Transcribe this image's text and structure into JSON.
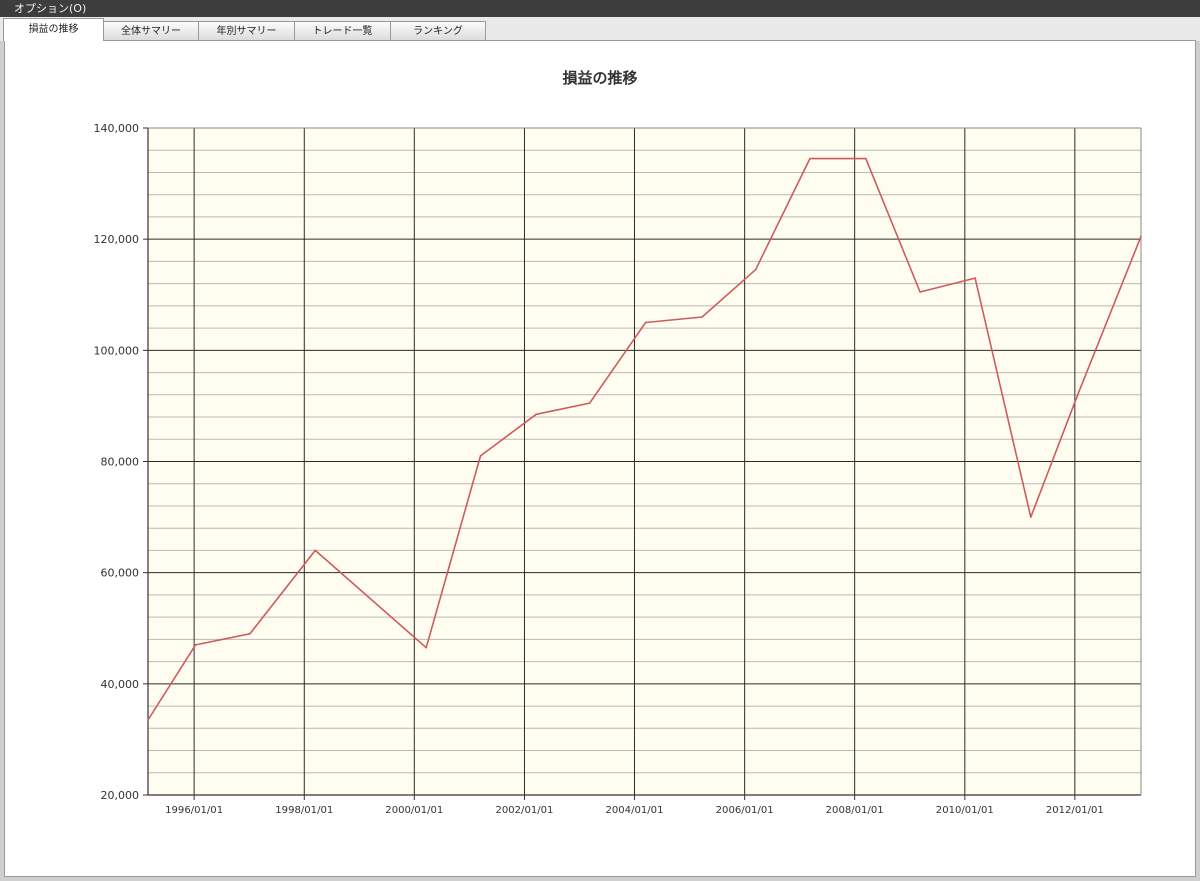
{
  "window": {
    "menu_label": "オプション(O)"
  },
  "tabs": [
    {
      "label": "損益の推移",
      "active": true
    },
    {
      "label": "全体サマリー",
      "active": false
    },
    {
      "label": "年別サマリー",
      "active": false
    },
    {
      "label": "トレード一覧",
      "active": false
    },
    {
      "label": "ランキング",
      "active": false
    }
  ],
  "colors": {
    "plot_background": "#fffdf0",
    "line": "#cd5c5c",
    "major_grid": "#2b2b2b",
    "minor_grid": "#b9b9b9"
  },
  "chart_data": {
    "type": "line",
    "title": "損益の推移",
    "xlabel": "",
    "ylabel": "",
    "ylim": [
      20000,
      140000
    ],
    "xlim": [
      "1995-03-01",
      "2013-03-15"
    ],
    "y_ticks": [
      "20,000",
      "40,000",
      "60,000",
      "80,000",
      "100,000",
      "120,000",
      "140,000"
    ],
    "x_ticks": [
      "1996/01/01",
      "1998/01/01",
      "2000/01/01",
      "2002/01/01",
      "2004/01/01",
      "2006/01/01",
      "2008/01/01",
      "2010/01/01",
      "2012/01/01"
    ],
    "grid": true,
    "series": [
      {
        "x": [
          "1995-03-01",
          "1996-01-10",
          "1997-01-05",
          "1998-03-15",
          "2000-03-20",
          "2001-03-15",
          "2002-03-20",
          "2003-03-10",
          "2004-03-15",
          "2005-03-25",
          "2006-03-15",
          "2007-03-10",
          "2008-03-15",
          "2009-03-10",
          "2010-03-10",
          "2011-03-15",
          "2012-01-20",
          "2013-03-15"
        ],
        "values": [
          33500,
          47000,
          49000,
          64000,
          46500,
          81000,
          88500,
          90500,
          105000,
          106000,
          114500,
          134500,
          134500,
          110500,
          113000,
          70000,
          92000,
          120500
        ]
      }
    ]
  }
}
